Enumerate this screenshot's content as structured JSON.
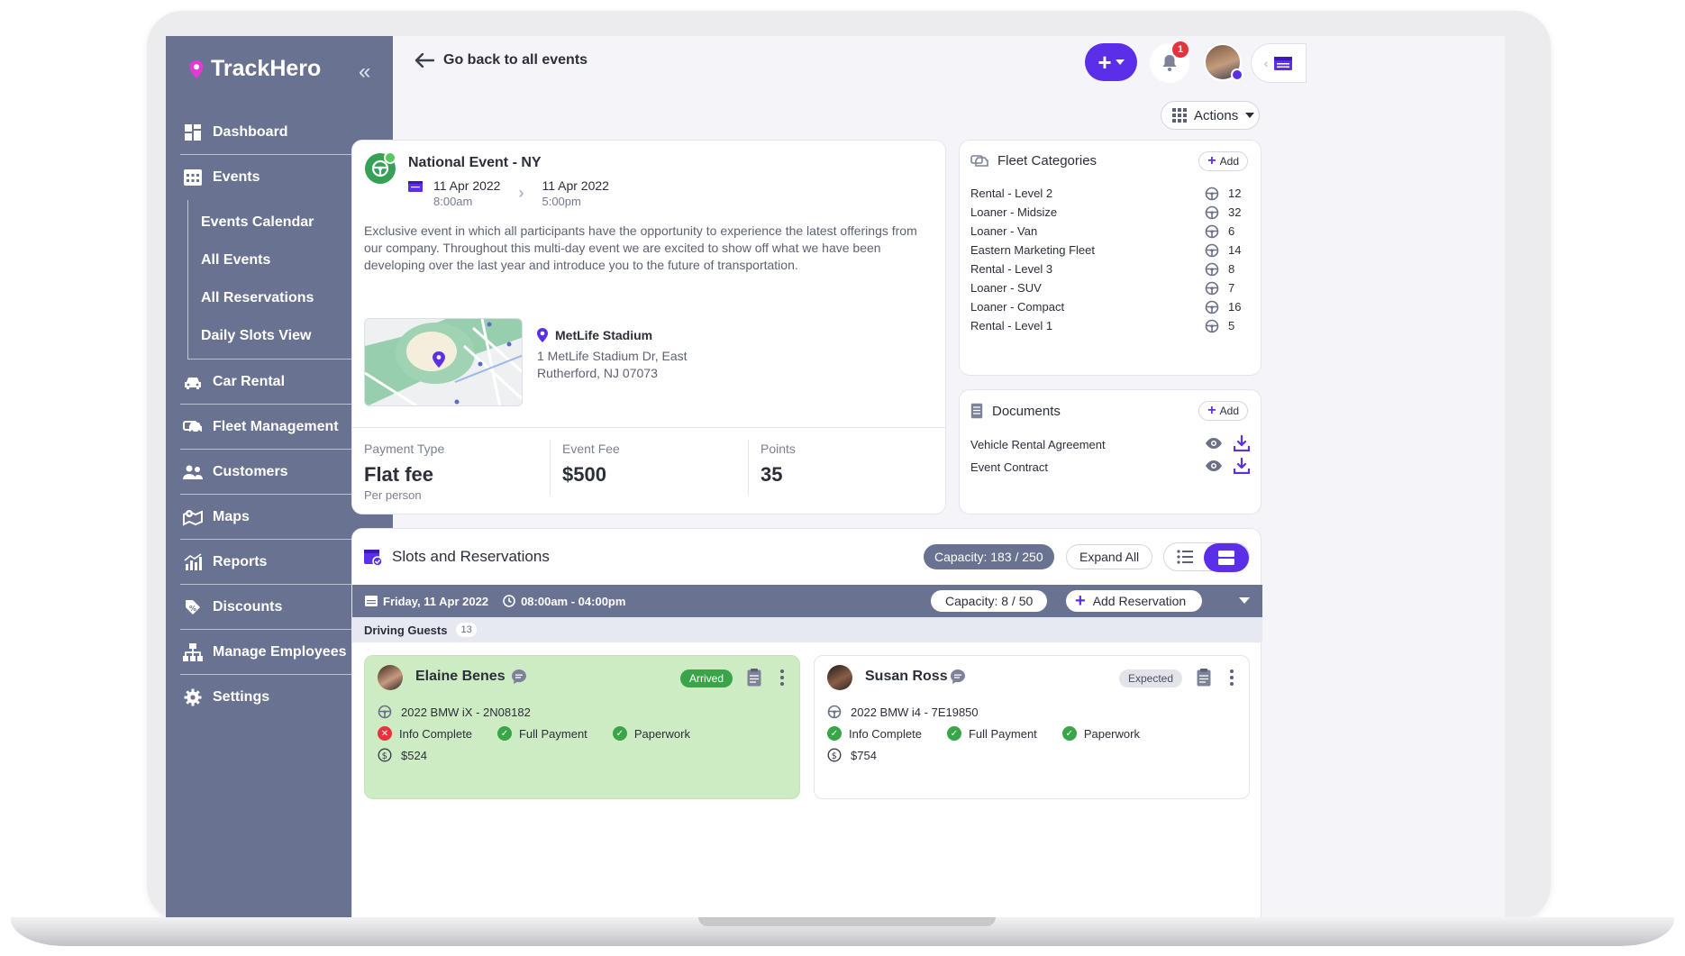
{
  "app": {
    "name": "TrackHero"
  },
  "sidebar": {
    "items": [
      {
        "label": "Dashboard",
        "icon": "dashboard-icon"
      },
      {
        "label": "Events",
        "icon": "calendar-grid-icon",
        "expanded": true,
        "children": [
          "Events Calendar",
          "All Events",
          "All Reservations",
          "Daily Slots View"
        ]
      },
      {
        "label": "Car Rental",
        "icon": "car-rental-icon"
      },
      {
        "label": "Fleet Management",
        "icon": "fleet-icon"
      },
      {
        "label": "Customers",
        "icon": "customers-icon"
      },
      {
        "label": "Maps",
        "icon": "map-icon"
      },
      {
        "label": "Reports",
        "icon": "reports-icon"
      },
      {
        "label": "Discounts",
        "icon": "discount-tag-icon"
      },
      {
        "label": "Manage Employees",
        "icon": "org-chart-icon"
      },
      {
        "label": "Settings",
        "icon": "gear-icon"
      }
    ]
  },
  "header": {
    "back_label": "Go back to all events",
    "notifications_count": "1",
    "actions_label": "Actions"
  },
  "event": {
    "title": "National Event - NY",
    "start_date": "11 Apr 2022",
    "start_time": "8:00am",
    "end_date": "11 Apr 2022",
    "end_time": "5:00pm",
    "description": "Exclusive event in which all participants have the opportunity to experience the latest offerings from our company.  Throughout this multi-day event we are excited to show off what we have been developing over the last year and introduce you to the future of transportation.",
    "venue_name": "MetLife Stadium",
    "venue_address": "1 MetLife Stadium Dr, East Rutherford, NJ 07073",
    "payment_type_label": "Payment Type",
    "payment_type": "Flat fee",
    "payment_type_sub": "Per person",
    "fee_label": "Event Fee",
    "fee": "$500",
    "points_label": "Points",
    "points": "35"
  },
  "fleet": {
    "title": "Fleet Categories",
    "add_label": "Add",
    "items": [
      {
        "name": "Rental - Level 2",
        "count": "12"
      },
      {
        "name": "Loaner - Midsize",
        "count": "32"
      },
      {
        "name": "Loaner - Van",
        "count": "6"
      },
      {
        "name": "Eastern Marketing Fleet",
        "count": "14"
      },
      {
        "name": "Rental - Level 3",
        "count": "8"
      },
      {
        "name": "Loaner - SUV",
        "count": "7"
      },
      {
        "name": "Loaner - Compact",
        "count": "16"
      },
      {
        "name": "Rental - Level 1",
        "count": "5"
      }
    ]
  },
  "documents": {
    "title": "Documents",
    "add_label": "Add",
    "items": [
      "Vehicle Rental Agreement",
      "Event Contract"
    ]
  },
  "slots": {
    "title": "Slots and Reservations",
    "capacity": "Capacity: 183 / 250",
    "expand_label": "Expand All",
    "slot_date": "Friday, 11 Apr 2022",
    "slot_time": "08:00am - 04:00pm",
    "slot_capacity": "Capacity: 8 / 50",
    "add_reservation": "Add Reservation",
    "guests_label": "Driving Guests",
    "guests_count": "13"
  },
  "guests": [
    {
      "name": "Elaine Benes",
      "status": "Arrived",
      "vehicle": "2022 BMW iX  - 2N08182",
      "checks": [
        {
          "label": "Info Complete",
          "ok": false
        },
        {
          "label": "Full Payment",
          "ok": true
        },
        {
          "label": "Paperwork",
          "ok": true
        }
      ],
      "amount": "$524"
    },
    {
      "name": "Susan Ross",
      "status": "Expected",
      "vehicle": "2022 BMW i4 - 7E19850",
      "checks": [
        {
          "label": "Info Complete",
          "ok": true
        },
        {
          "label": "Full Payment",
          "ok": true
        },
        {
          "label": "Paperwork",
          "ok": true
        }
      ],
      "amount": "$754"
    }
  ],
  "colors": {
    "accent": "#5b2ee8",
    "sidebar": "#6a7292",
    "success": "#3aa548",
    "danger": "#e5333d",
    "arrived_card": "#cdecc4"
  }
}
